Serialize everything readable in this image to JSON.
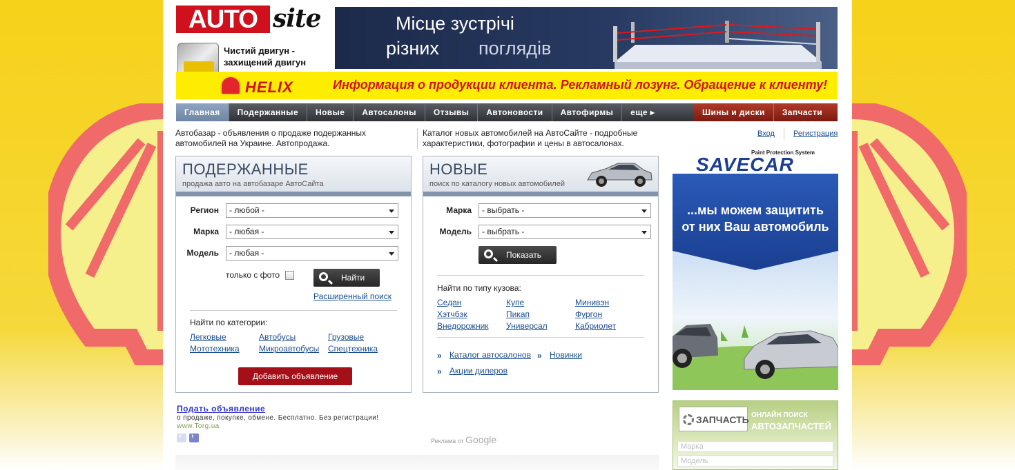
{
  "header": {
    "logo_auto": "AUTO",
    "logo_site": "site",
    "oil_ad_line1": "Чистий двигун -",
    "oil_ad_line2": "захищений двигун",
    "banner_top_line1": "Місце зустрічі",
    "banner_top_line2": "різних",
    "banner_top_line3": "поглядів",
    "helix_brand": "HELIX",
    "helix_slogan": "Информация о продукции клиента. Рекламный лозунг. Обращение к клиенту!"
  },
  "nav": {
    "items": [
      "Главная",
      "Подержанные",
      "Новые",
      "Автосалоны",
      "Отзывы",
      "Автоновости",
      "Автофирмы",
      "еще ▸"
    ],
    "active_index": 0,
    "red_items": [
      "Шины и диски",
      "Запчасти"
    ]
  },
  "intro": {
    "left": "Автобазар - объявления о продаже подержанных автомобилей на Украине. Автопродажа.",
    "right": "Каталог новых автомобилей на АвтоСайте - подробные характеристики, фотографии и цены в автосалонах."
  },
  "auth": {
    "login": "Вход",
    "register": "Регистрация"
  },
  "used": {
    "title": "ПОДЕРЖАННЫЕ",
    "subtitle": "продажа авто на автобазаре АвтоСайта",
    "region_label": "Регион",
    "region_value": "- любой -",
    "make_label": "Марка",
    "make_value": "- любая -",
    "model_label": "Модель",
    "model_value": "- любая -",
    "photo_only_label": "только с фото",
    "find_button": "Найти",
    "advanced_search": "Расширенный поиск",
    "category_heading": "Найти по категории:",
    "categories": [
      "Легковые",
      "Автобусы",
      "Грузовые",
      "Мототехника",
      "Микроавтобусы",
      "Спецтехника"
    ],
    "add_button": "Добавить объявление"
  },
  "new": {
    "title": "НОВЫЕ",
    "subtitle": "поиск по каталогу новых автомобилей",
    "make_label": "Марка",
    "make_value": "- выбрать -",
    "model_label": "Модель",
    "model_value": "- выбрать -",
    "show_button": "Показать",
    "body_heading": "Найти по типу кузова:",
    "body_types": [
      "Седан",
      "Купе",
      "Минивэн",
      "Хэтчбэк",
      "Пикап",
      "Фургон",
      "Внедорожник",
      "Универсал",
      "Кабриолет"
    ],
    "links": [
      "Каталог автосалонов",
      "Новинки",
      "Акции дилеров"
    ]
  },
  "savecar": {
    "tagline": "Paint Protection System",
    "logo": "SAVECAR",
    "line1": "...мы можем защитить",
    "line2": "от них Ваш автомобиль"
  },
  "zapchast": {
    "logo": "ЗАПЧАСТЬ",
    "line1": "ОНЛАЙН ПОИСК",
    "line2": "АВТОЗАПЧАСТЕЙ",
    "select1": "Марка",
    "select2": "Модель"
  },
  "google_ad": {
    "title": "Подать объявление",
    "desc": "о продаже, покупке, обмене. Бесплатно. Без регистрации!",
    "url": "www.Torg.ua",
    "ads_by": "Реклама от",
    "google": "Google"
  },
  "colors": {
    "shell_yellow": "#f7d21a",
    "shell_red": "#e2262c",
    "nav_dark": "#3a3d42",
    "nav_red": "#8a2214",
    "link_blue": "#1a4d8c",
    "add_button_red": "#a51018"
  }
}
